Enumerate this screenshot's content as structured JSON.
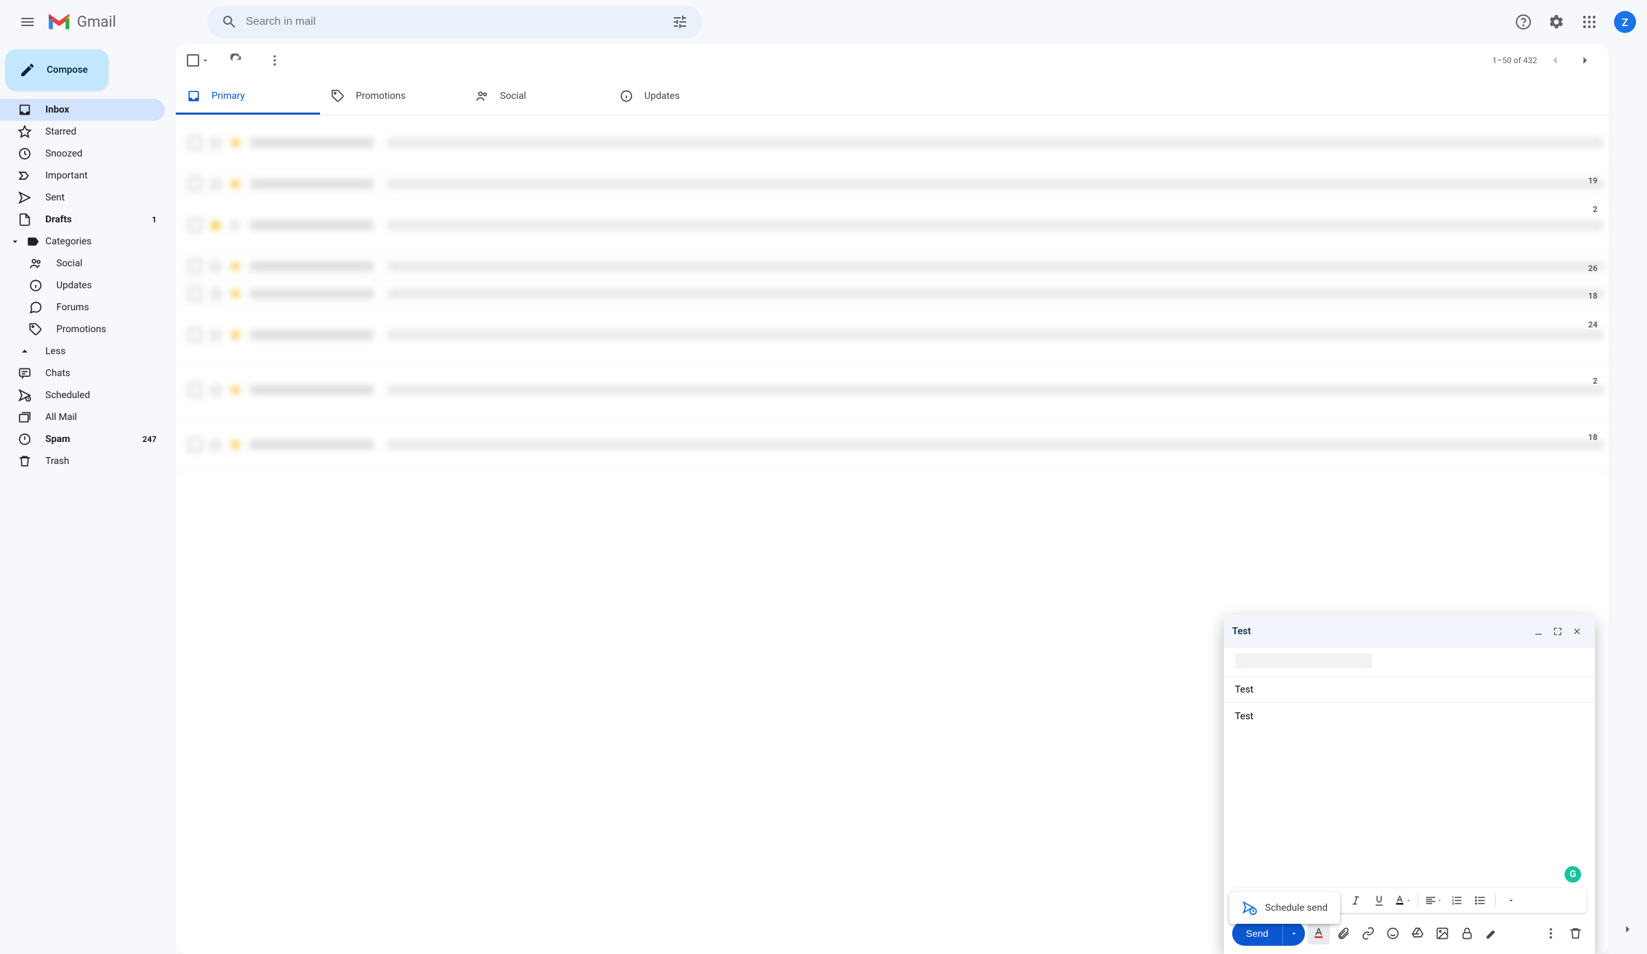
{
  "header": {
    "app_name": "Gmail",
    "search_placeholder": "Search in mail",
    "avatar_letter": "Z"
  },
  "compose_button": "Compose",
  "sidebar": {
    "items": [
      {
        "label": "Inbox",
        "count": "",
        "active": true,
        "bold": true
      },
      {
        "label": "Starred"
      },
      {
        "label": "Snoozed"
      },
      {
        "label": "Important"
      },
      {
        "label": "Sent"
      },
      {
        "label": "Drafts",
        "count": "1",
        "bold": true
      },
      {
        "label": "Categories"
      },
      {
        "label": "Social",
        "sub": true
      },
      {
        "label": "Updates",
        "sub": true
      },
      {
        "label": "Forums",
        "sub": true
      },
      {
        "label": "Promotions",
        "sub": true
      },
      {
        "label": "Less"
      },
      {
        "label": "Chats"
      },
      {
        "label": "Scheduled"
      },
      {
        "label": "All Mail"
      },
      {
        "label": "Spam",
        "count": "247",
        "bold": true
      },
      {
        "label": "Trash"
      }
    ]
  },
  "toolbar": {
    "pagination": "1–50 of 432"
  },
  "tabs": [
    {
      "label": "Primary",
      "active": true
    },
    {
      "label": "Promotions"
    },
    {
      "label": "Social"
    },
    {
      "label": "Updates"
    }
  ],
  "mail_dates": [
    "",
    "19",
    "2",
    "",
    "26",
    "18",
    "24",
    "",
    "2",
    "",
    "18"
  ],
  "compose_window": {
    "title": "Test",
    "subject": "Test",
    "body": "Test",
    "send_label": "Send",
    "schedule_label": "Schedule send"
  }
}
